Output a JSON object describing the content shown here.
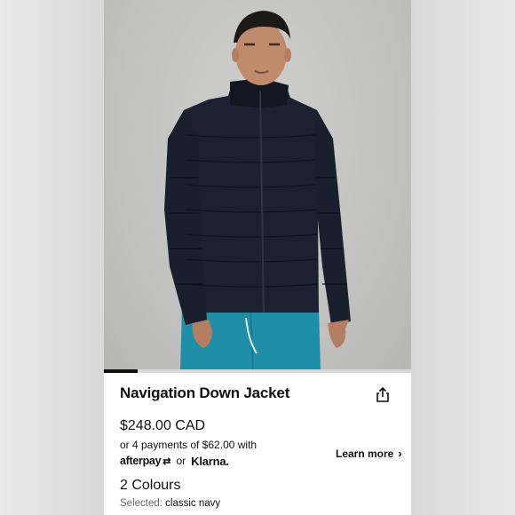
{
  "product": {
    "name": "Navigation Down Jacket",
    "price": "$248.00 CAD",
    "installments_text": "or 4 payments of $62.00 with",
    "afterpay_label": "afterpay",
    "afterpay_mark": "⇄",
    "or_label": "or",
    "klarna_label": "Klarna.",
    "learn_more_label": "Learn more",
    "learn_more_chevron": "›",
    "colours_label": "2 Colours",
    "selected_label": "Selected:",
    "selected_value": "classic navy"
  },
  "gallery": {
    "progress_fraction": 0.11
  },
  "icons": {
    "share": "share-icon"
  },
  "colors": {
    "text": "#111111",
    "jacket": "#1b2130",
    "shorts": "#1f8ea7"
  }
}
